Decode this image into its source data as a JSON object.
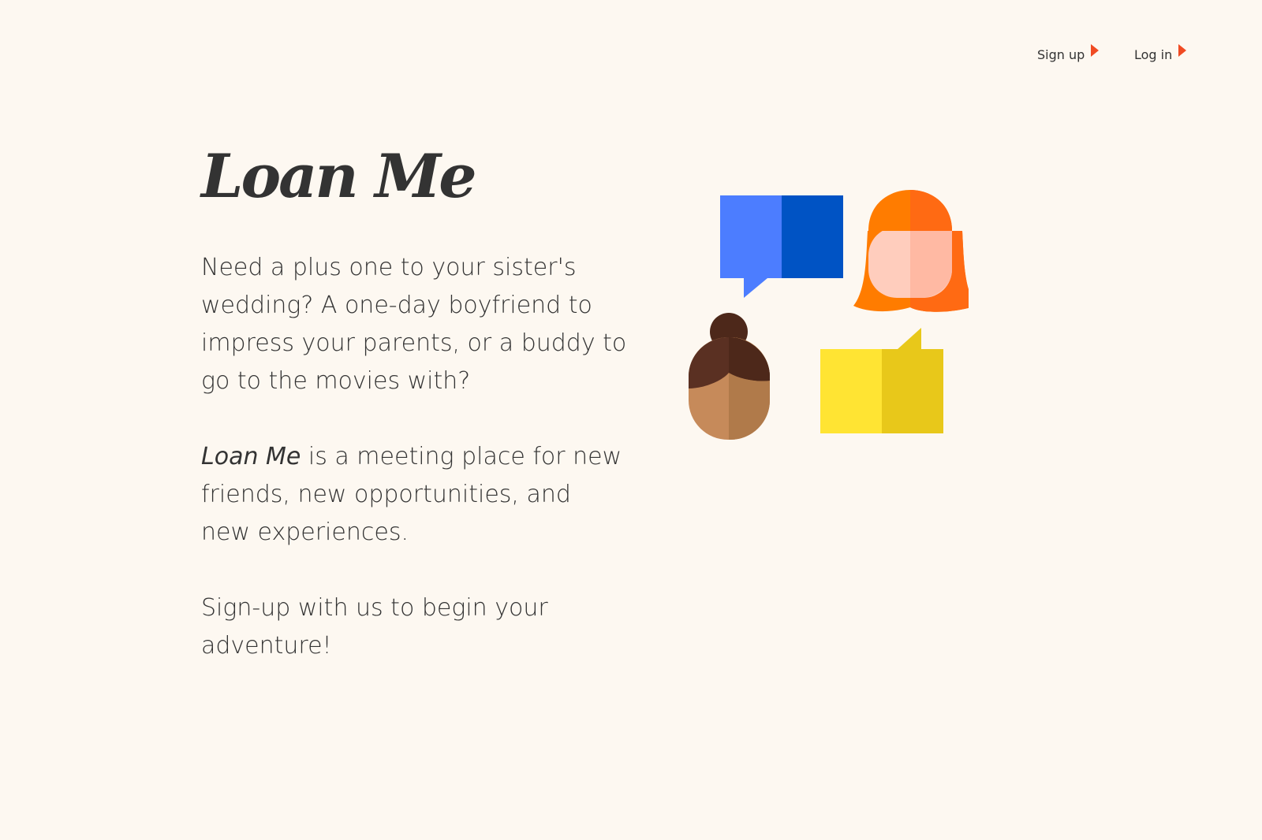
{
  "nav": {
    "signup_label": "Sign up",
    "login_label": "Log in"
  },
  "hero": {
    "logo": "Loan Me",
    "paragraph1": "Need a plus one to your sister's wedding? A one-day boyfriend to impress your parents, or a buddy to go to the movies with?",
    "paragraph2_em": "Loan Me",
    "paragraph2_rest": " is a meeting place for new friends, new opportunities, and new experiences.",
    "paragraph3": "Sign-up with us to begin your adventure!"
  },
  "colors": {
    "background": "#fdf8f1",
    "accent": "#f04b23",
    "text": "#333333",
    "blue_light": "#4c7dff",
    "blue_dark": "#0053c4",
    "yellow_light": "#ffe433",
    "yellow_dark": "#e8c81a",
    "orange_hair": "#ff7c00",
    "skin_light": "#ffcdbd",
    "hair_brown": "#5a3022",
    "skin_brown": "#c68a5a"
  },
  "icons": [
    "arrow-right-icon",
    "chat-bubble-icon",
    "person-avatar-icon"
  ]
}
